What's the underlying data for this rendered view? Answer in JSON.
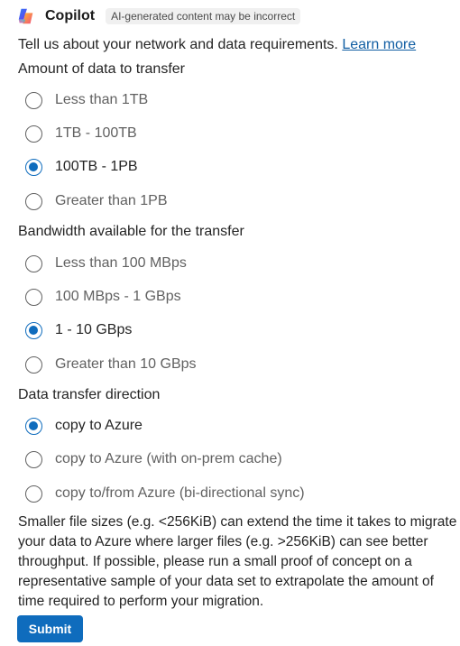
{
  "header": {
    "app_name": "Copilot",
    "disclaimer": "AI-generated content may be incorrect",
    "logo_icon": "copilot-logo-icon"
  },
  "intro": {
    "text": "Tell us about your network and data requirements.",
    "link": "Learn more"
  },
  "sections": [
    {
      "title": "Amount of data to transfer",
      "options": [
        "Less than 1TB",
        "1TB - 100TB",
        "100TB - 1PB",
        "Greater than 1PB"
      ],
      "selected": "100TB - 1PB"
    },
    {
      "title": "Bandwidth available for the transfer",
      "options": [
        "Less than 100 MBps",
        "100 MBps - 1 GBps",
        "1 - 10 GBps",
        "Greater than 10 GBps"
      ],
      "selected": "1 - 10 GBps"
    },
    {
      "title": "Data transfer direction",
      "options": [
        "copy to Azure",
        "copy to Azure (with on-prem cache)",
        "copy to/from Azure (bi-directional sync)"
      ],
      "selected": "copy to Azure"
    }
  ],
  "note": "Smaller file sizes (e.g. <256KiB) can extend the time it takes to migrate your data to Azure where larger files (e.g. >256KiB) can see better throughput. If possible, please run a small proof of concept on a representative sample of your data set to extrapolate the amount of time required to perform your migration.",
  "submit_label": "Submit",
  "colors": {
    "accent": "#0f6cbd",
    "link": "#115ea3"
  }
}
